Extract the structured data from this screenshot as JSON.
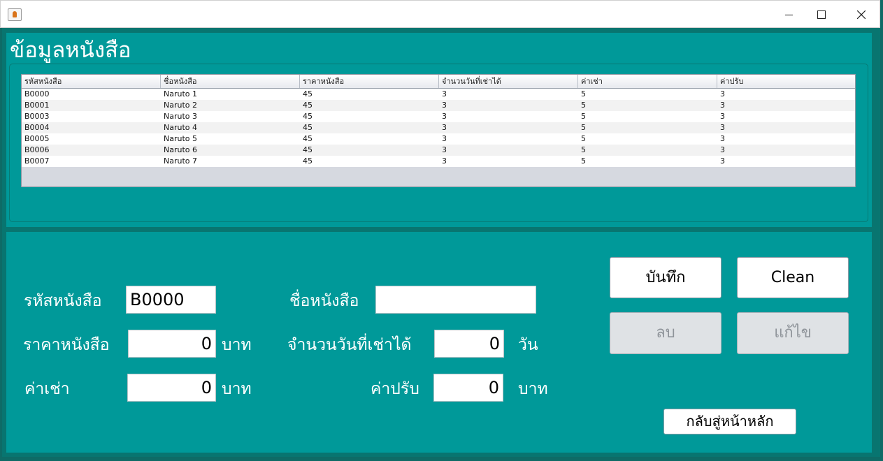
{
  "window": {
    "minimize_label": "",
    "maximize_label": "",
    "close_label": ""
  },
  "header": {
    "title": "ข้อมูลหนังสือ"
  },
  "table": {
    "columns": [
      "รหัสหนังสือ",
      "ชื่อหนังสือ",
      "ราคาหนังสือ",
      "จำนวนวันที่เช่าได้",
      "ค่าเช่า",
      "ค่าปรับ"
    ],
    "rows": [
      [
        "B0000",
        "Naruto 1",
        "45",
        "3",
        "5",
        "3"
      ],
      [
        "B0001",
        "Naruto 2",
        "45",
        "3",
        "5",
        "3"
      ],
      [
        "B0003",
        "Naruto 3",
        "45",
        "3",
        "5",
        "3"
      ],
      [
        "B0004",
        "Naruto 4",
        "45",
        "3",
        "5",
        "3"
      ],
      [
        "B0005",
        "Naruto 5",
        "45",
        "3",
        "5",
        "3"
      ],
      [
        "B0006",
        "Naruto 6",
        "45",
        "3",
        "5",
        "3"
      ],
      [
        "B0007",
        "Naruto 7",
        "45",
        "3",
        "5",
        "3"
      ]
    ]
  },
  "form": {
    "book_id_label": "รหัสหนังสือ",
    "book_id_value": "B0000",
    "book_name_label": "ชื่อหนังสือ",
    "book_name_value": "",
    "price_label": "ราคาหนังสือ",
    "price_value": "0",
    "price_unit": "บาท",
    "rent_days_label": "จำนวนวันที่เช่าได้",
    "rent_days_value": "0",
    "rent_days_unit": "วัน",
    "rent_fee_label": "ค่าเช่า",
    "rent_fee_value": "0",
    "rent_fee_unit": "บาท",
    "fine_label": "ค่าปรับ",
    "fine_value": "0",
    "fine_unit": "บาท"
  },
  "buttons": {
    "save": "บันทึก",
    "clean": "Clean",
    "delete": "ลบ",
    "edit": "แก้ไข",
    "back": "กลับสู่หน้าหลัก"
  }
}
